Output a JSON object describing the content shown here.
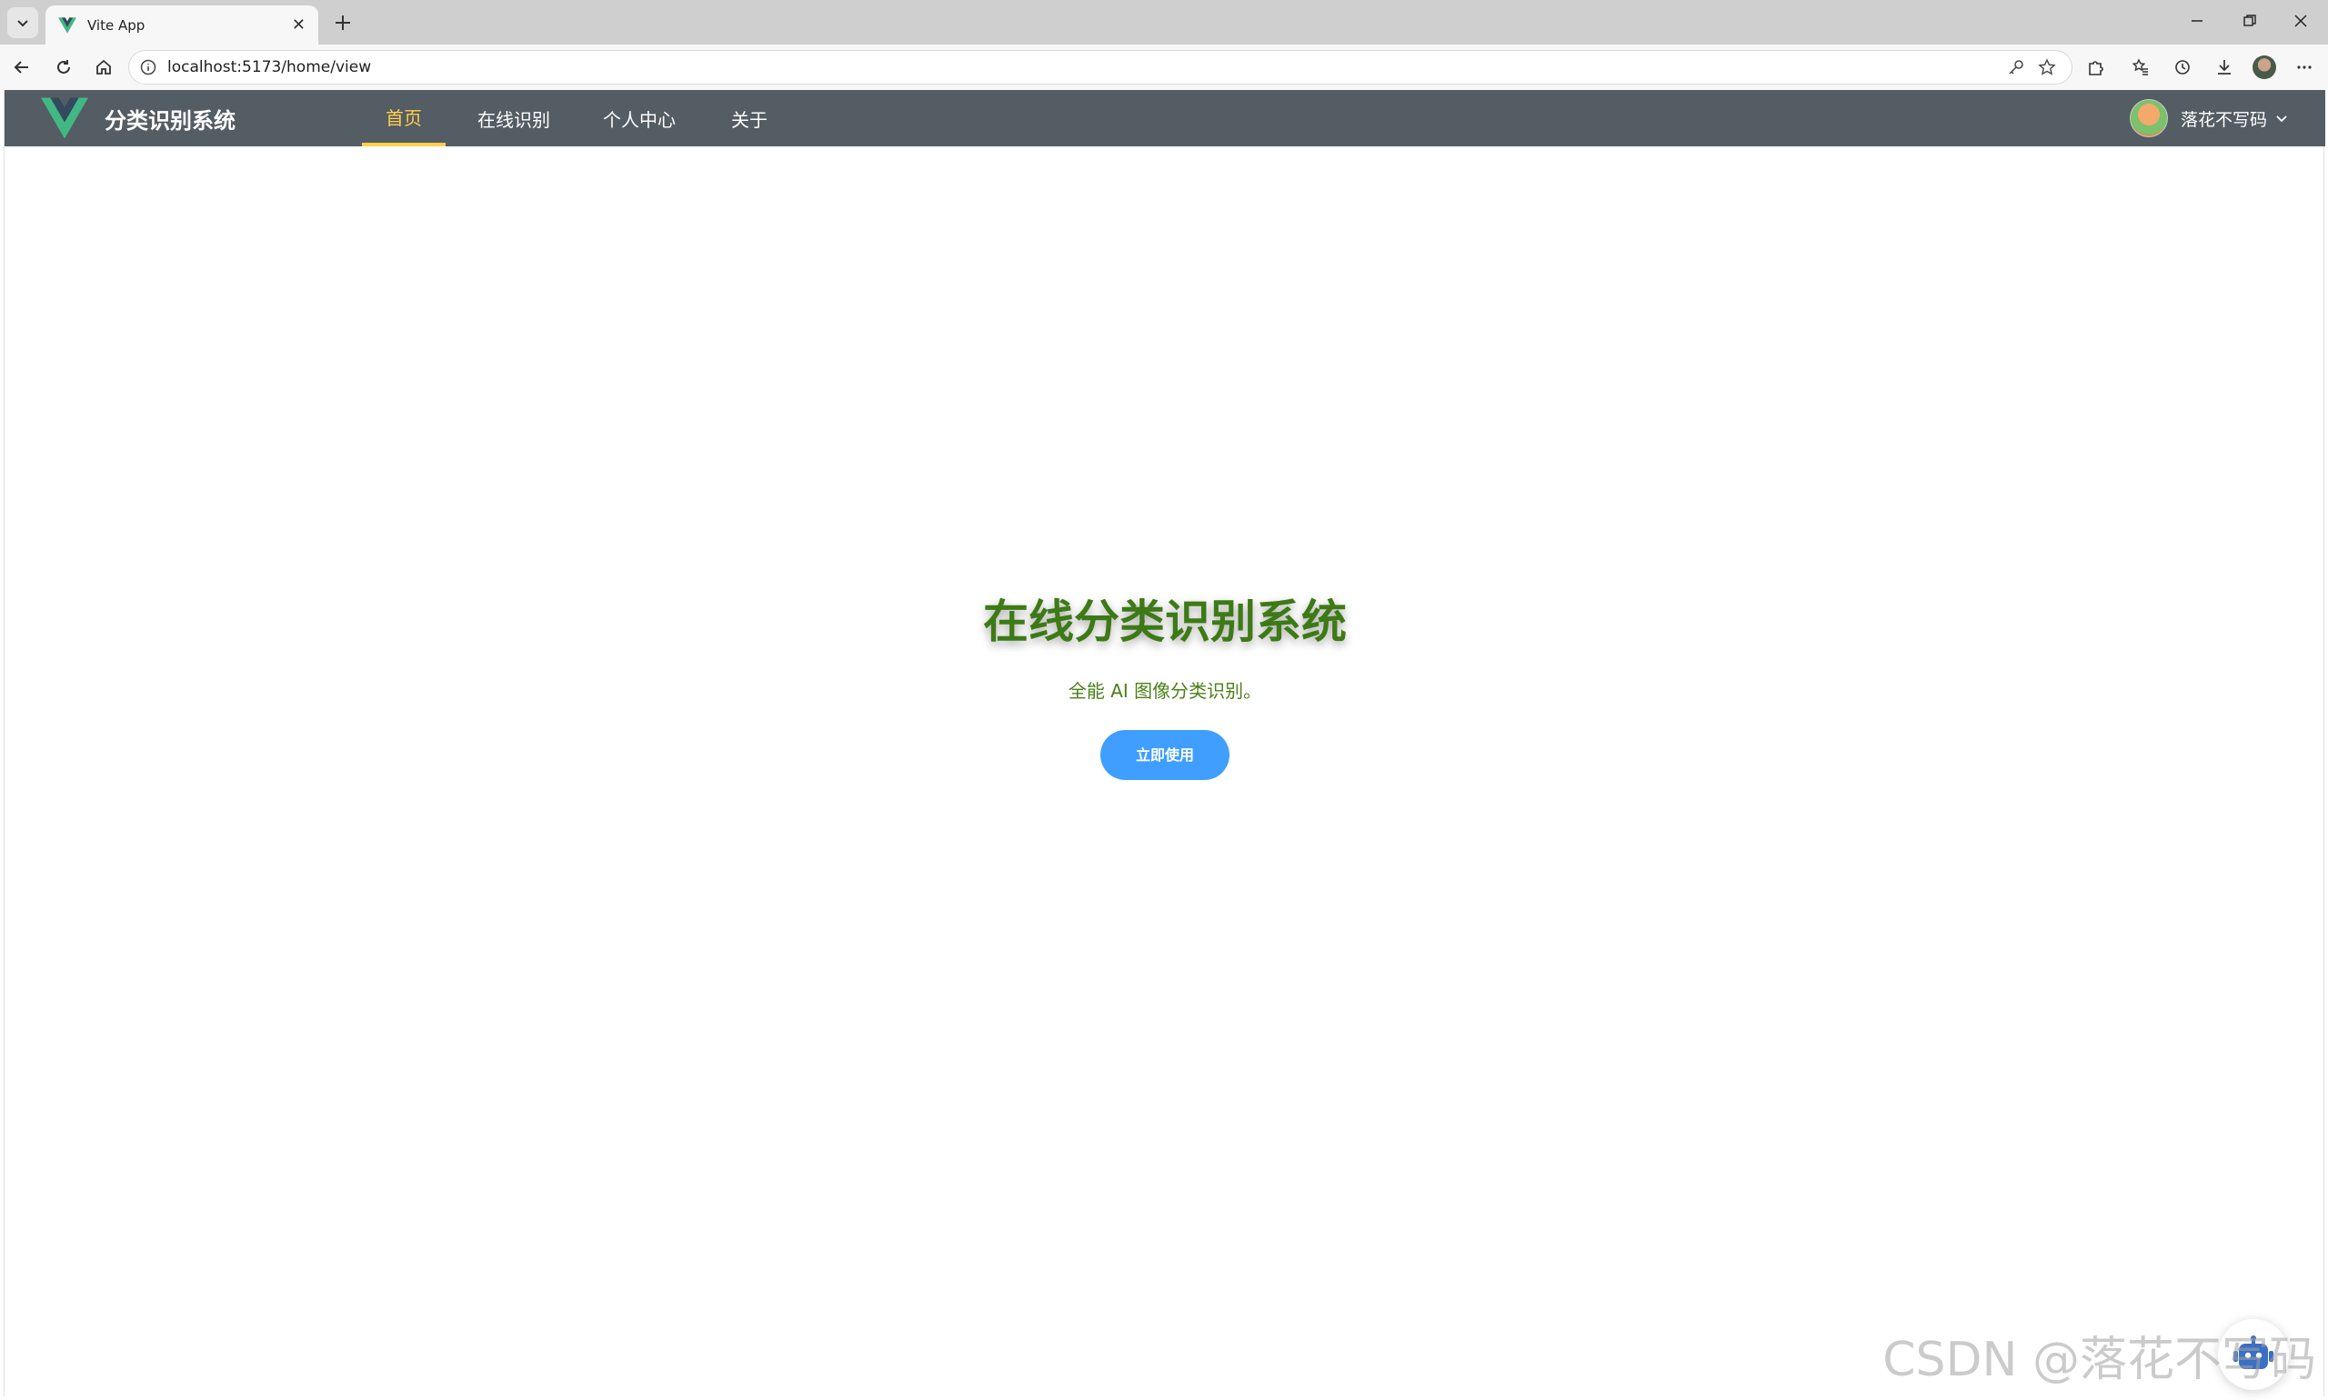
{
  "browser": {
    "tab_title": "Vite App",
    "url": "localhost:5173/home/view"
  },
  "navbar": {
    "brand_title": "分类识别系统",
    "items": [
      {
        "label": "首页",
        "active": true
      },
      {
        "label": "在线识别",
        "active": false
      },
      {
        "label": "个人中心",
        "active": false
      },
      {
        "label": "关于",
        "active": false
      }
    ],
    "username": "落花不写码",
    "colors": {
      "background": "#545c64",
      "active": "#ffd04b",
      "text": "#ffffff"
    }
  },
  "hero": {
    "title": "在线分类识别系统",
    "subtitle": "全能 AI 图像分类识别。",
    "cta_label": "立即使用",
    "colors": {
      "title": "#3d7a16",
      "button": "#409eff"
    }
  },
  "watermark": "CSDN @落花不写码",
  "icons": {
    "brand": "vue-logo-icon",
    "fab": "robot-icon"
  }
}
